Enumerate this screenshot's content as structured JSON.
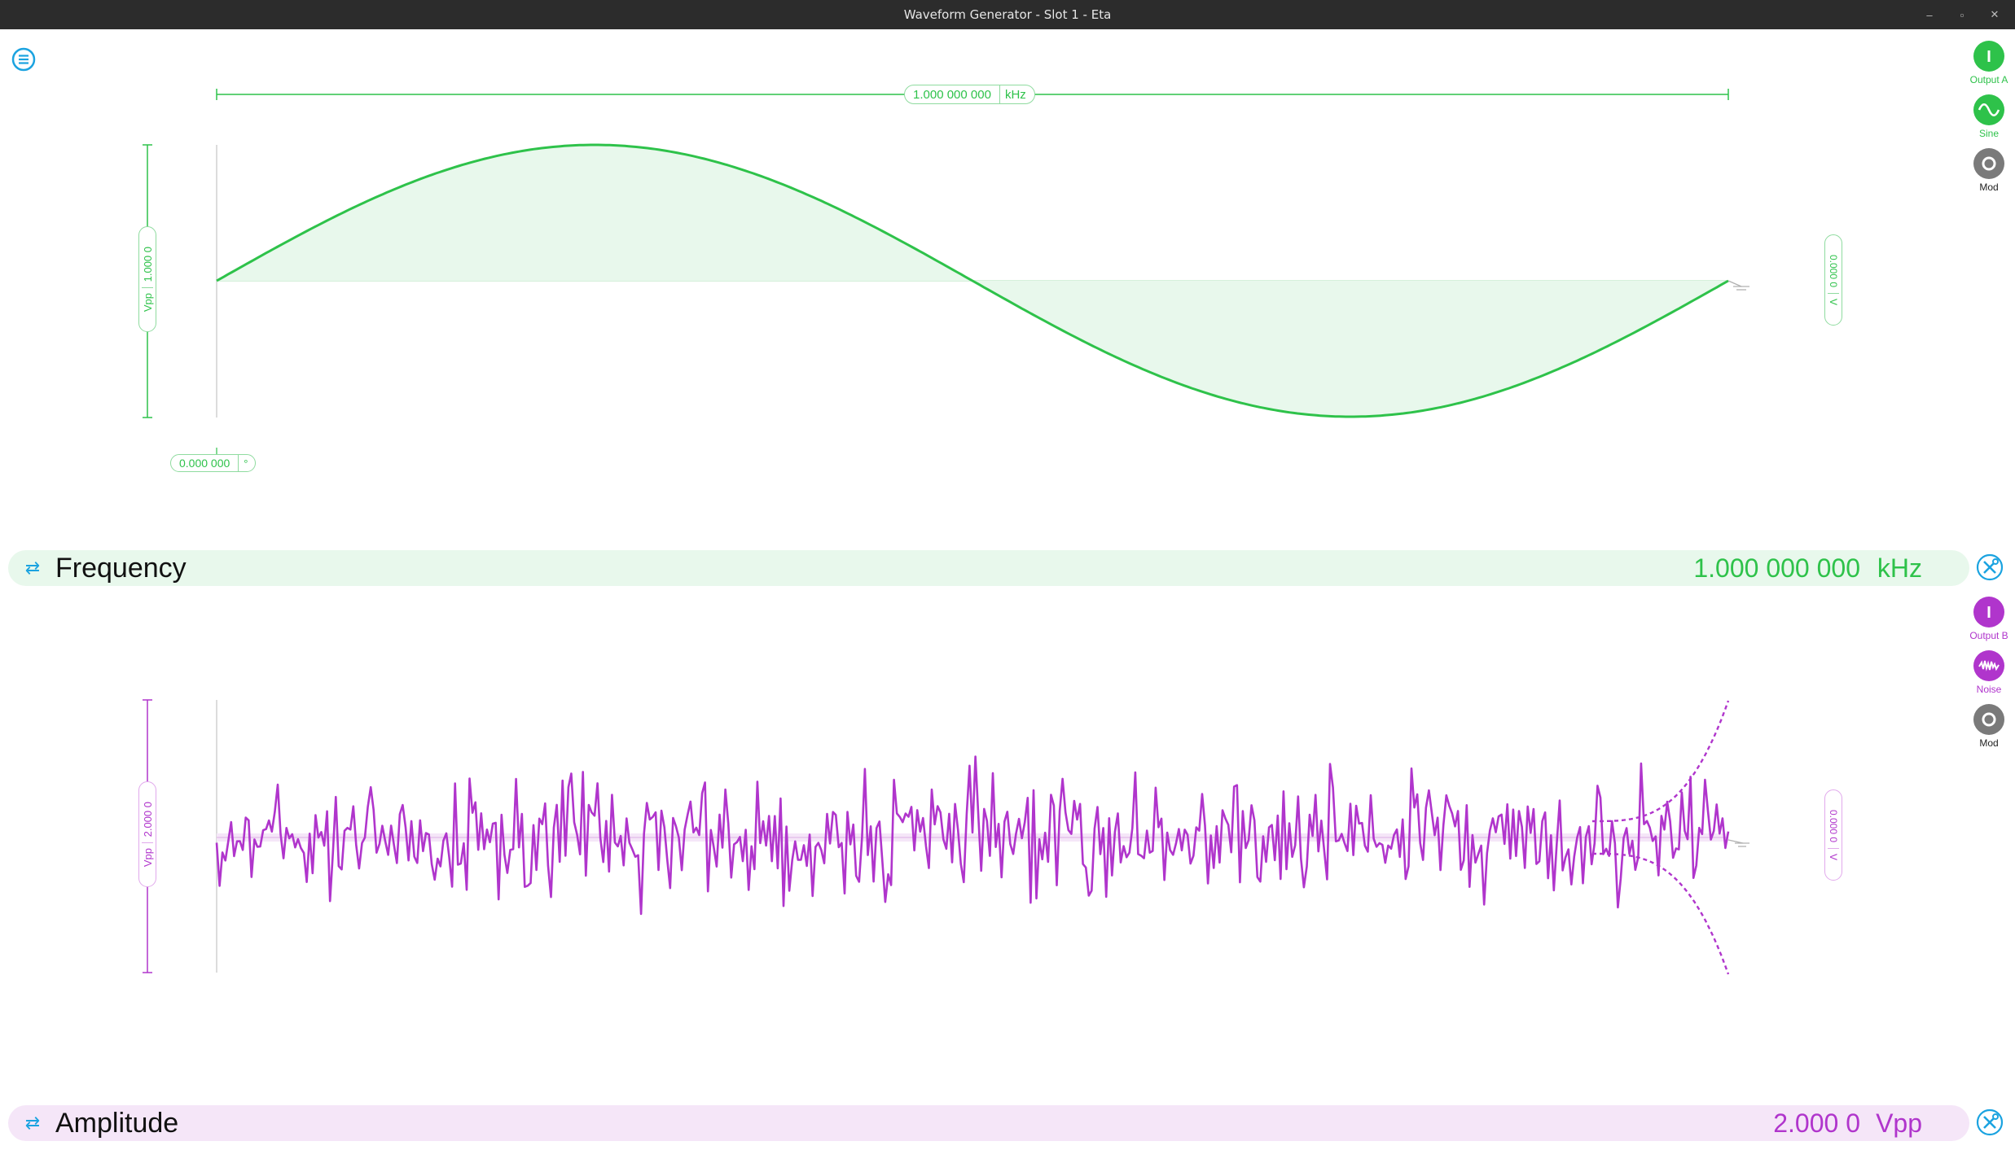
{
  "window": {
    "title": "Waveform Generator - Slot 1 - Eta",
    "controls": [
      "–",
      "▫",
      "✕"
    ]
  },
  "channel_a": {
    "color": "#2ec24a",
    "fill": "#e8f8ec",
    "frequency_value": "1.000 000 000",
    "frequency_unit": "kHz",
    "amplitude_value": "1.000 0",
    "amplitude_unit": "Vpp",
    "phase_value": "0.000 000",
    "phase_unit": "°",
    "offset_value": "0.000 0",
    "offset_unit": "V",
    "buttons": {
      "output_label": "Output A",
      "wave_label": "Sine",
      "mod_label": "Mod"
    },
    "parameter_bar": {
      "name": "Frequency",
      "value": "1.000 000 000",
      "unit": "kHz"
    }
  },
  "channel_b": {
    "color": "#b035cc",
    "fill": "#f5e6f8",
    "amplitude_value": "2.000 0",
    "amplitude_unit": "Vpp",
    "offset_value": "0.000 0",
    "offset_unit": "V",
    "buttons": {
      "output_label": "Output B",
      "wave_label": "Noise",
      "mod_label": "Mod"
    },
    "parameter_bar": {
      "name": "Amplitude",
      "value": "2.000 0",
      "unit": "Vpp"
    }
  },
  "icons": {
    "menu": "menu-icon",
    "swap": "swap-arrows-icon",
    "tools": "tools-icon",
    "power": "power-icon",
    "sine": "sine-wave-icon",
    "noise": "noise-wave-icon",
    "mod": "mod-ring-icon",
    "ground": "ground-icon"
  }
}
